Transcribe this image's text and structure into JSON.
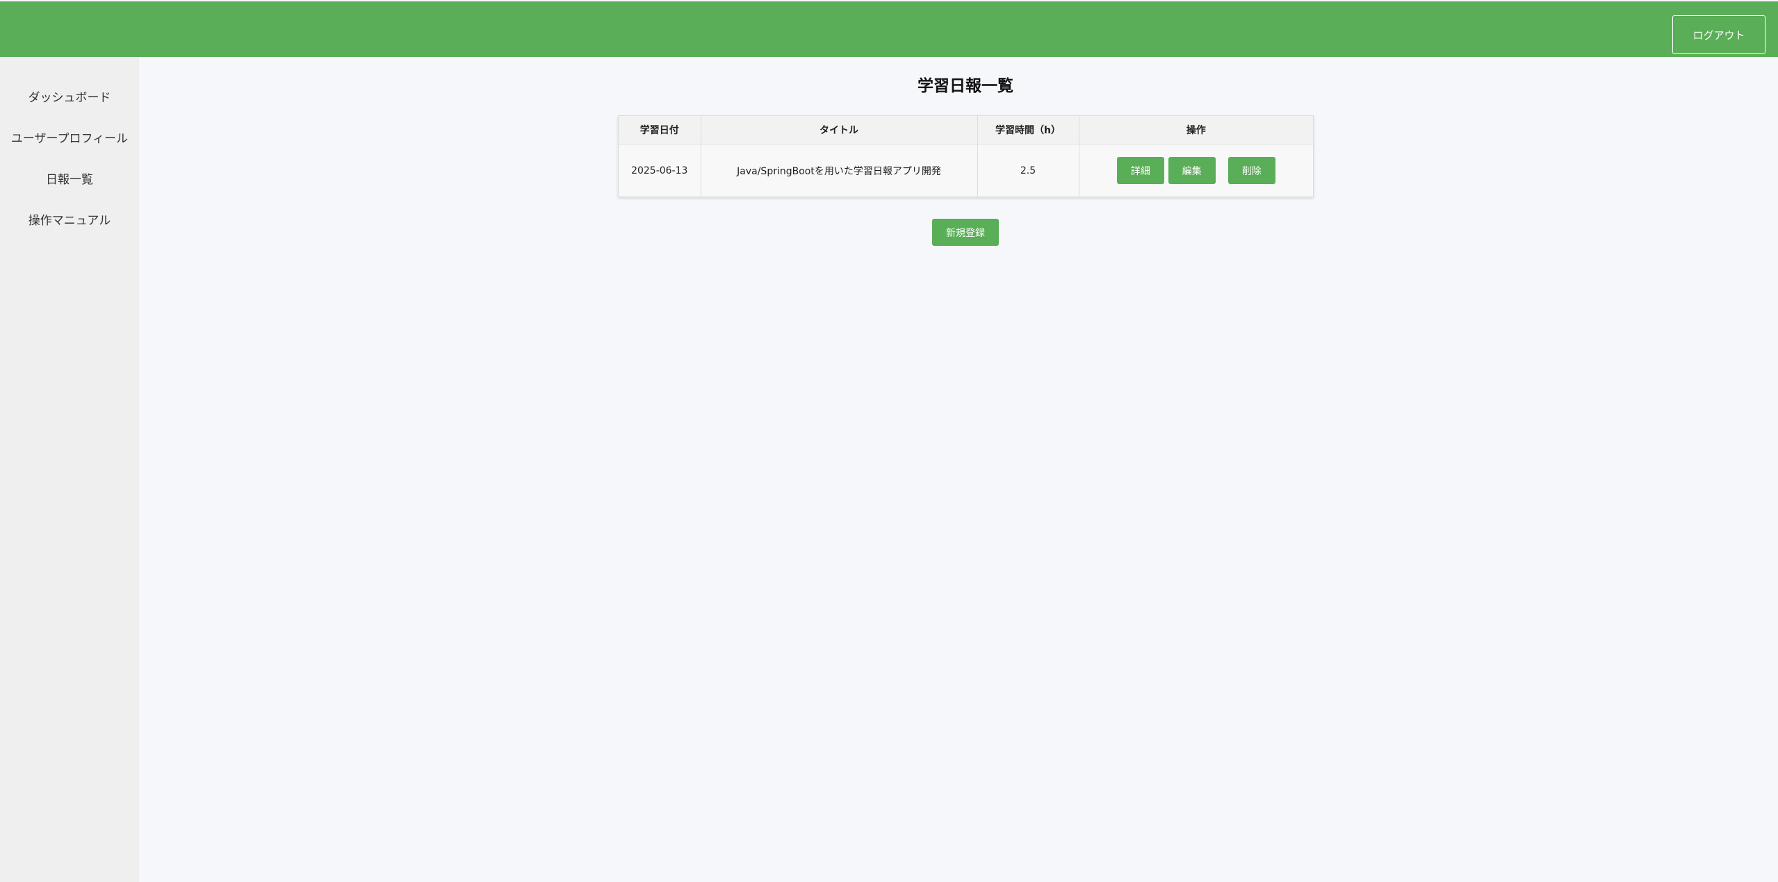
{
  "header": {
    "logout_label": "ログアウト",
    "bg_color": "#5aae57"
  },
  "sidebar": {
    "items": [
      {
        "label": "ダッシュボード"
      },
      {
        "label": "ユーザープロフィール"
      },
      {
        "label": "日報一覧"
      },
      {
        "label": "操作マニュアル"
      }
    ]
  },
  "main": {
    "title": "学習日報一覧",
    "table": {
      "headers": [
        "学習日付",
        "タイトル",
        "学習時間（h）",
        "操作"
      ],
      "rows": [
        {
          "date": "2025-06-13",
          "title": "Java/SpringBootを用いた学習日報アプリ開発",
          "hours": "2.5",
          "actions": {
            "detail": "詳細",
            "edit": "編集",
            "delete": "削除"
          }
        }
      ]
    },
    "new_button_label": "新規登録"
  }
}
